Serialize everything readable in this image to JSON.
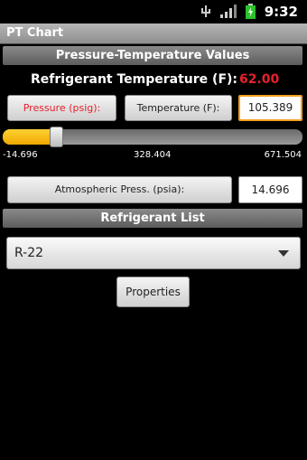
{
  "status_bar": {
    "time": "9:32"
  },
  "app": {
    "title": "PT Chart"
  },
  "pt_section": {
    "header": "Pressure-Temperature Values",
    "temp_label": "Refrigerant Temperature (F):",
    "temp_value": "62.00",
    "pressure_button": "Pressure (psig):",
    "temperature_button": "Temperature (F):",
    "temperature_field": "105.389",
    "slider": {
      "min_label": "-14.696",
      "mid_label": "328.404",
      "max_label": "671.504",
      "position_fraction": 0.18
    },
    "atm_button": "Atmospheric Press. (psia):",
    "atm_field": "14.696"
  },
  "refrigerant_section": {
    "header": "Refrigerant List",
    "selected": "R-22",
    "properties_button": "Properties"
  },
  "colors": {
    "accent_red": "#e8202a",
    "slider_fill": "#f0a800",
    "focus_border": "#f0a020"
  }
}
